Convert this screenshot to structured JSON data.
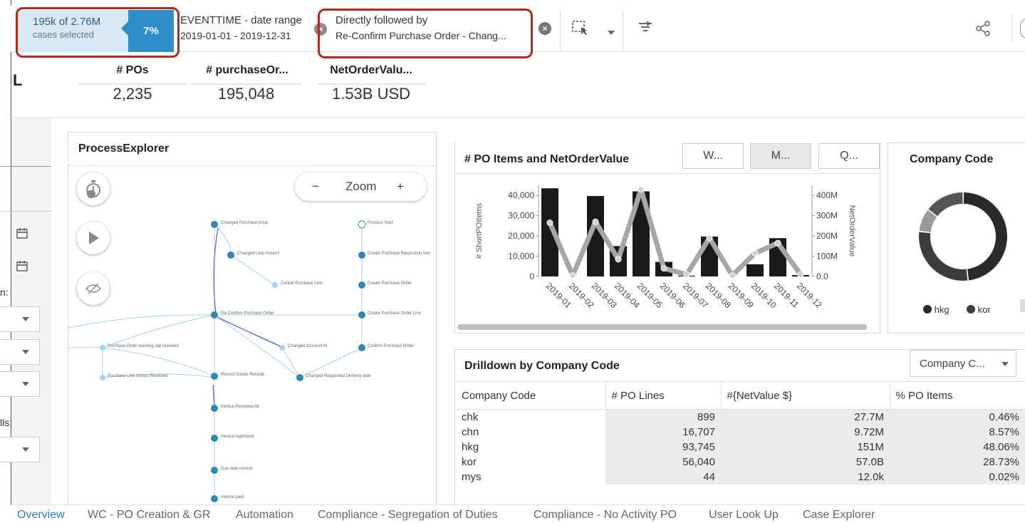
{
  "selection": {
    "count_text": "195k of 2.76M",
    "sub_text": "cases selected",
    "percent": "7%"
  },
  "filters": [
    {
      "title": "EVENTTIME - date range",
      "value": "2019-01-01 - 2019-12-31"
    },
    {
      "title": "Directly followed by",
      "value": "Re-Confirm Purchase Order - Chang..."
    }
  ],
  "sheet_letter": "L",
  "kpis": [
    {
      "title": "# POs",
      "value": "2,235"
    },
    {
      "title": "# purchaseOr...",
      "value": "195,048"
    },
    {
      "title": "NetOrderValu...",
      "value": "1.53B USD"
    }
  ],
  "sidebar": {
    "label_1": "n:",
    "label_2": "lls:"
  },
  "process_explorer": {
    "title": "ProcessExplorer",
    "zoom_label": "Zoom",
    "zoom_minus": "−",
    "zoom_plus": "+",
    "nodes": [
      "Changed Purchase price",
      "Changed Line Amount",
      "Cancel Purchase Line",
      "Re-Confirm Purchase Order",
      "Changed discount %",
      "Purchase Order packing slip received",
      "Purchase Line Goods Received",
      "Record Goods Receipt",
      "Changed Requested Delivery date",
      "Invoice Received All",
      "Invoice Approved",
      "Due date invoice",
      "Invoice paid",
      "Process Start",
      "Create Purchase Requisition line",
      "Create Purchase Order",
      "Create Purchase Order Line",
      "Confirm Purchase Order"
    ]
  },
  "po_chart": {
    "title": "# PO Items and NetOrderValue",
    "buttons": [
      "W...",
      "M...",
      "Q..."
    ],
    "active_button": 1
  },
  "chart_data": {
    "type": "bar",
    "title": "# PO Items and NetOrderValue",
    "categories": [
      "2019-01",
      "2019-02",
      "2019-03",
      "2019-04",
      "2019-05",
      "2019-06",
      "2019-07",
      "2019-08",
      "2019-09",
      "2019-10",
      "2019-11",
      "2019-12"
    ],
    "ylabel": "# ShortPOItems",
    "y2label": "NetOrderValue",
    "ylim": [
      0,
      45000
    ],
    "y2lim": [
      0,
      450000000
    ],
    "yticks": [
      "0",
      "10,000",
      "20,000",
      "30,000",
      "40,000"
    ],
    "y2ticks": [
      "0.0",
      "100M",
      "200M",
      "300M",
      "400M"
    ],
    "series": [
      {
        "values": [
          43500,
          0,
          39700,
          15000,
          42000,
          7200,
          400,
          19700,
          0,
          6000,
          18900,
          700
        ]
      },
      {
        "values": [
          265000000,
          5000000,
          270000000,
          85000000,
          430000000,
          40000000,
          10000000,
          190000000,
          5000000,
          115000000,
          165000000,
          10000000
        ]
      }
    ],
    "bar_color": "#1a1a1a",
    "line_color": "#a6a6a6"
  },
  "company_card": {
    "title": "Company Code",
    "legend": [
      "hkg",
      "kor"
    ],
    "slices": [
      {
        "label": "hkg",
        "value": 48.06,
        "color": "#2a2a2a"
      },
      {
        "label": "kor",
        "value": 28.73,
        "color": "#3c3c3c"
      },
      {
        "label": "chn",
        "value": 8.57,
        "color": "#9a9a9a"
      },
      {
        "label": "other",
        "value": 14.64,
        "color": "#555555"
      }
    ]
  },
  "drilldown": {
    "title": "Drilldown by Company Code",
    "dropdown_label": "Company C...",
    "columns": [
      "Company Code",
      "# PO Lines",
      "#{NetValue $}",
      "% PO Items"
    ],
    "rows": [
      [
        "chk",
        "899",
        "27.7M",
        "0.46%"
      ],
      [
        "chn",
        "16,707",
        "9.72M",
        "8.57%"
      ],
      [
        "hkg",
        "93,745",
        "151M",
        "48.06%"
      ],
      [
        "kor",
        "56,040",
        "57.0B",
        "28.73%"
      ],
      [
        "mys",
        "44",
        "12.0k",
        "0.02%"
      ]
    ]
  },
  "bottom_tabs": [
    "Overview",
    "WC - PO Creation & GR",
    "Automation",
    "Compliance - Segregation of Duties",
    "Compliance - No Activity PO",
    "User Look Up",
    "Case Explorer"
  ],
  "colors": {
    "accent": "#2f8ec9",
    "highlight_border": "#b22a1f",
    "selection_bg": "#d9e9f4"
  }
}
